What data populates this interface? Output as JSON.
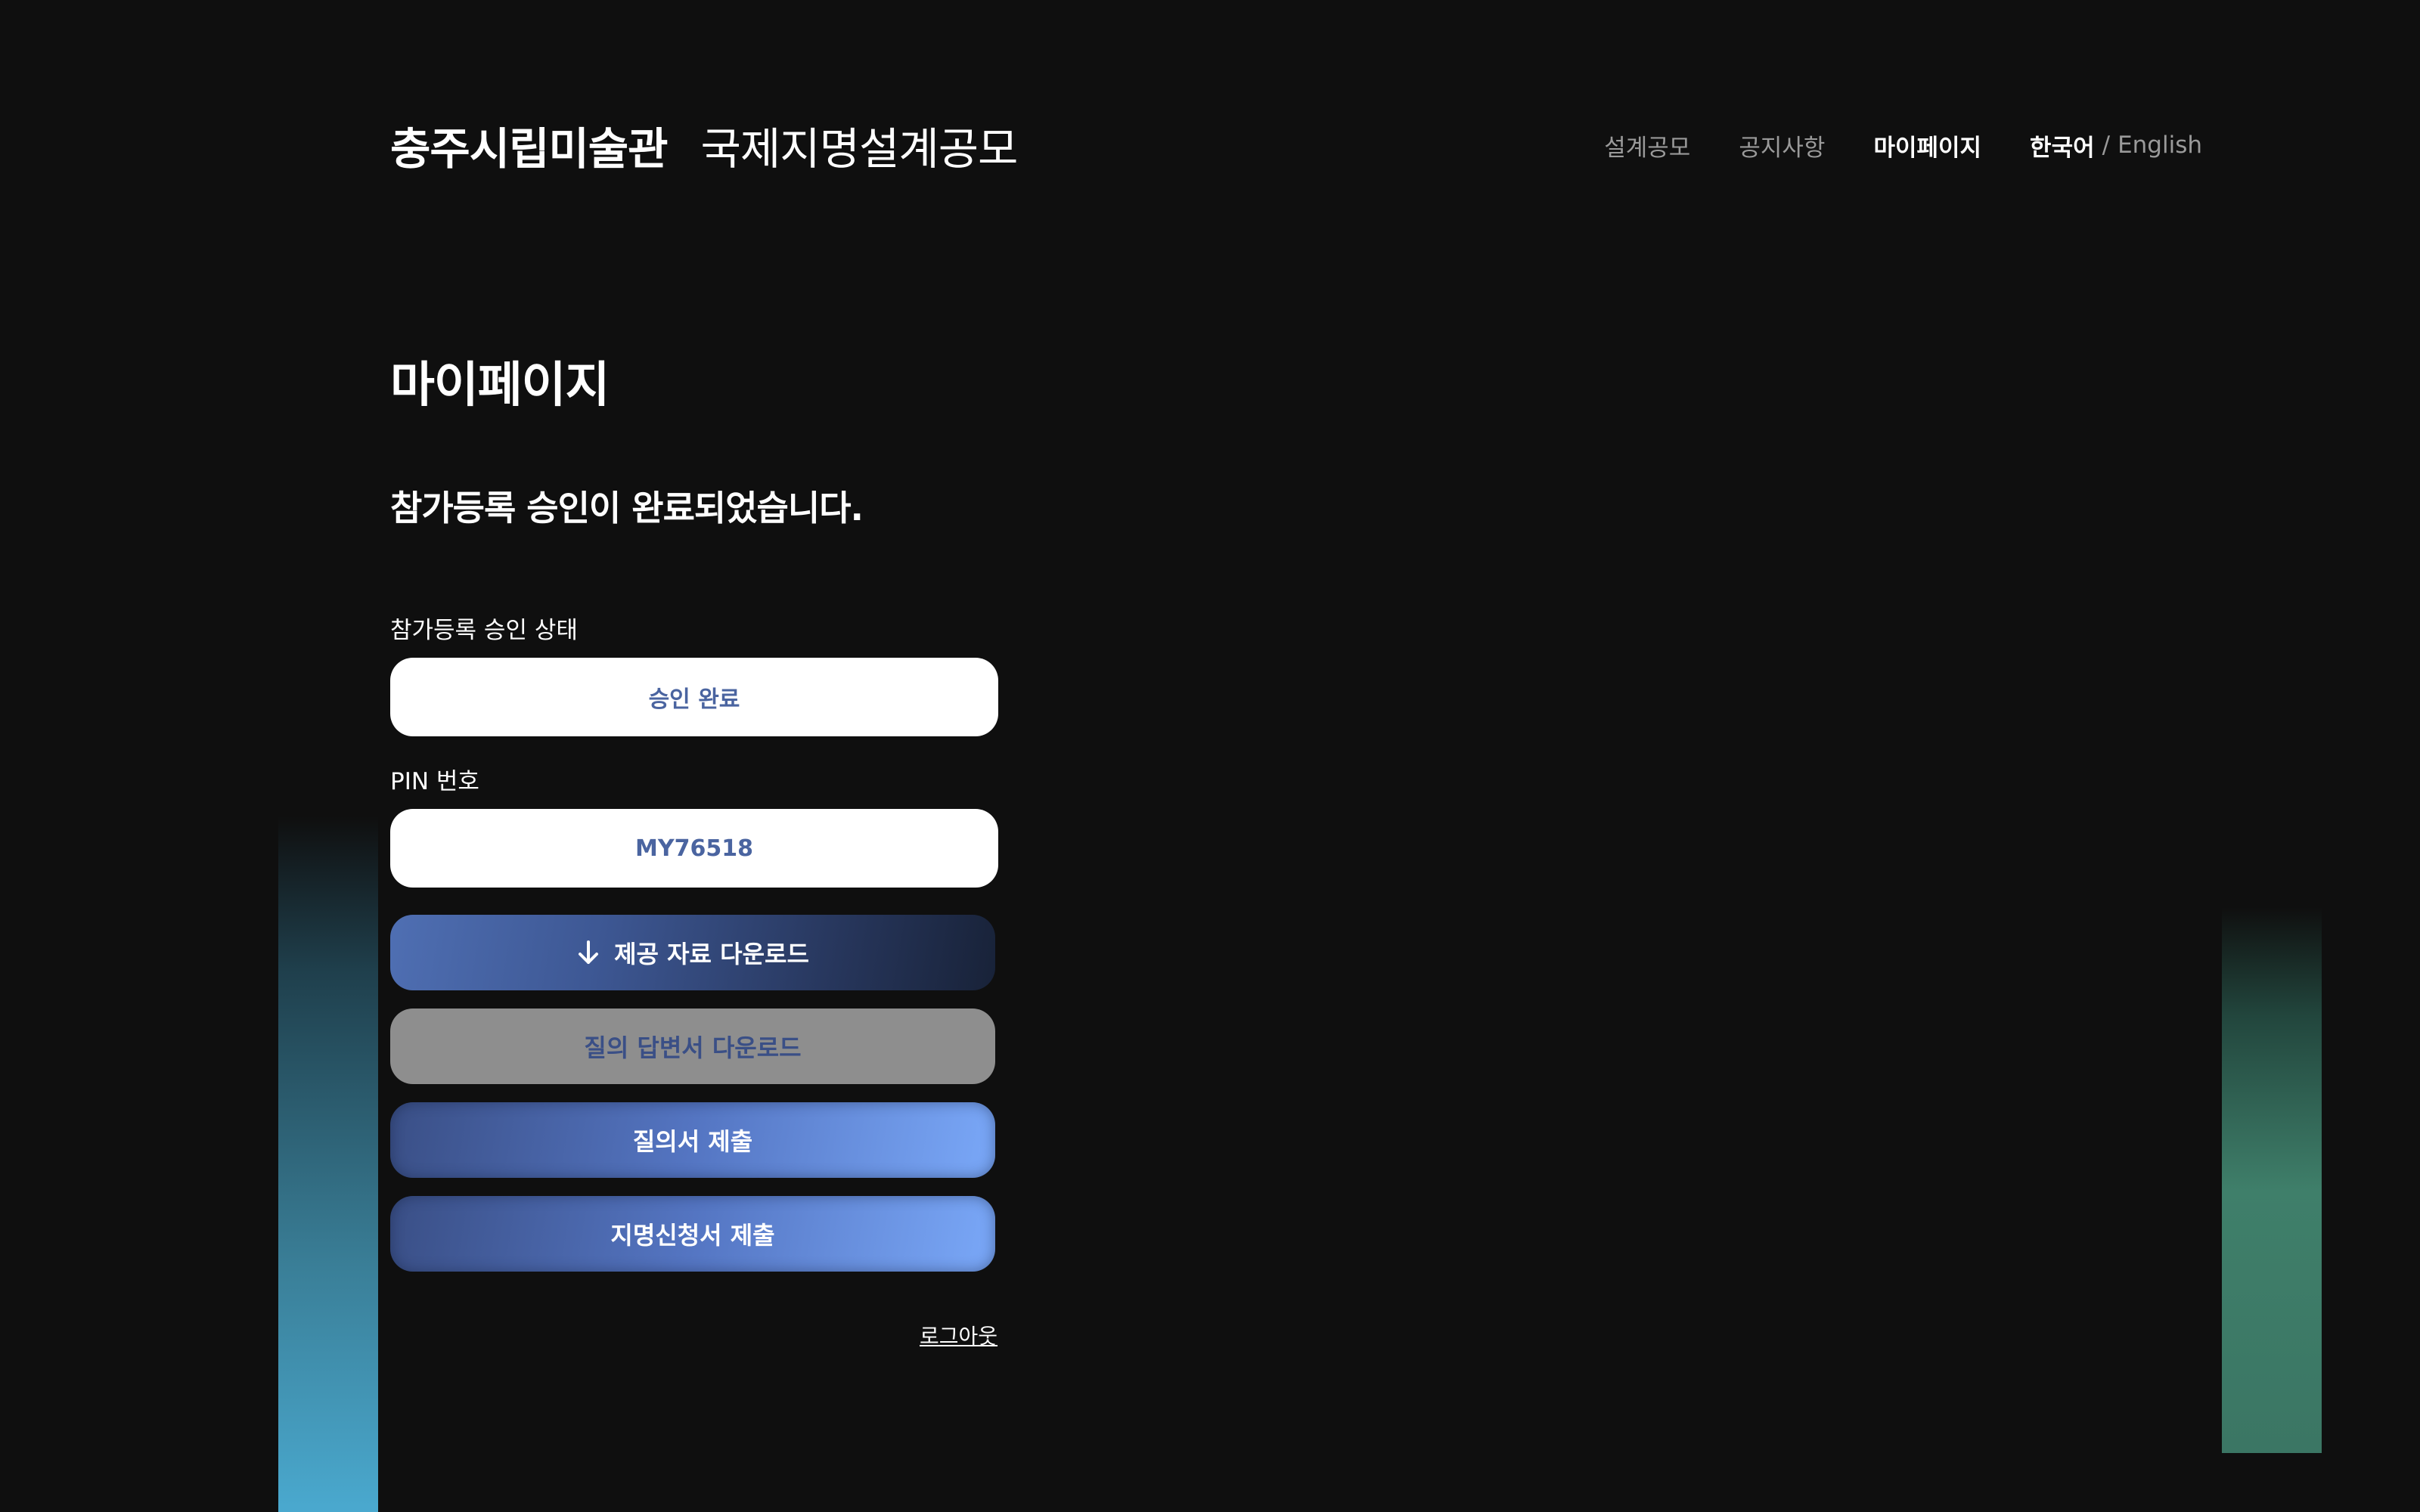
{
  "header": {
    "brand_main": "충주시립미술관",
    "brand_sub": "국제지명설계공모",
    "nav": [
      {
        "label": "설계공모",
        "active": false
      },
      {
        "label": "공지사항",
        "active": false
      },
      {
        "label": "마이페이지",
        "active": true
      }
    ],
    "lang": {
      "ko": "한국어",
      "separator": "/",
      "en": "English"
    }
  },
  "main": {
    "page_title": "마이페이지",
    "status_message": "참가등록 승인이 완료되었습니다.",
    "approval": {
      "label": "참가등록 승인 상태",
      "value": "승인 완료"
    },
    "pin": {
      "label": "PIN 번호",
      "value": "MY76518"
    },
    "buttons": {
      "download_materials": "제공 자료 다운로드",
      "download_answers": "질의 답변서 다운로드",
      "submit_question": "질의서 제출",
      "submit_application": "지명신청서 제출"
    },
    "logout": "로그아웃"
  },
  "icons": {
    "download": "arrow-down-icon"
  },
  "colors": {
    "background": "#0f0f0f",
    "field_text": "#4a64a0",
    "button_accent": "#7aa8f8",
    "disabled": "#8e8e8e"
  }
}
